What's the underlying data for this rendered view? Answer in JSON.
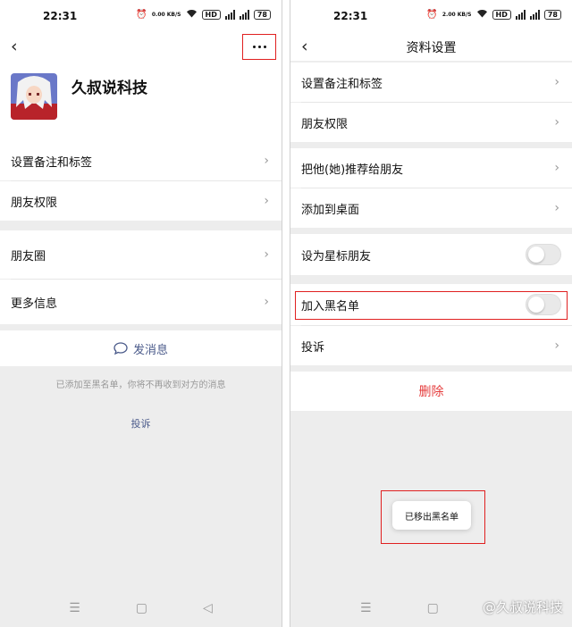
{
  "status": {
    "time": "22:31",
    "speed_left": "0.00 KB/S",
    "speed_right": "2.00 KB/S",
    "hd": "HD",
    "battery": "78"
  },
  "left": {
    "back_icon": "‹",
    "profile": {
      "name": "久叔说科技"
    },
    "rows": [
      {
        "label": "设置备注和标签"
      },
      {
        "label": "朋友权限"
      },
      {
        "label": "朋友圈"
      },
      {
        "label": "更多信息"
      }
    ],
    "send_message": "发消息",
    "blacklist_hint": "已添加至黑名单，你将不再收到对方的消息",
    "complain": "投诉"
  },
  "right": {
    "title": "资料设置",
    "rows": [
      {
        "label": "设置备注和标签"
      },
      {
        "label": "朋友权限"
      },
      {
        "label": "把他(她)推荐给朋友"
      },
      {
        "label": "添加到桌面"
      },
      {
        "label": "设为星标朋友"
      },
      {
        "label": "加入黑名单"
      },
      {
        "label": "投诉"
      }
    ],
    "star_toggle_on": false,
    "blacklist_toggle_on": false,
    "delete": "删除",
    "toast": "已移出黑名单"
  },
  "sysnav": {
    "menu": "☰",
    "home": "▢",
    "back": "◁"
  },
  "watermark": "@久叔说科技",
  "colors": {
    "highlight": "#e02020",
    "link": "#4a5a8a",
    "danger": "#e53d3d",
    "page_bg": "#ededed"
  }
}
